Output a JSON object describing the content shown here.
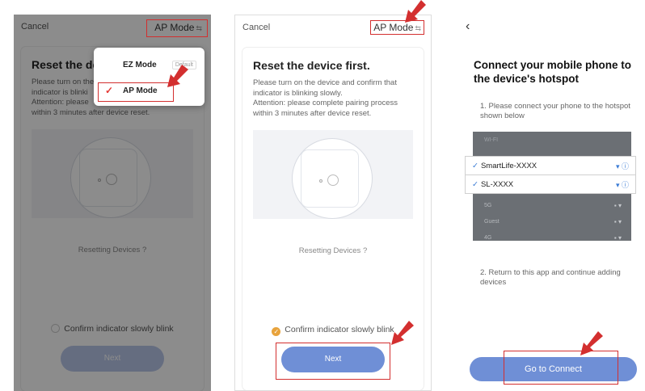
{
  "screen1": {
    "cancel": "Cancel",
    "mode": "AP Mode",
    "mode_icon": "⇆",
    "title": "Reset the de",
    "desc": "Please turn on the\nindicator is blinki\nAttention: please\nwithin 3 minutes after device reset.",
    "reset_link": "Resetting Devices ?",
    "confirm": "Confirm indicator slowly blink",
    "next": "Next",
    "dropdown": {
      "ez_label": "EZ Mode",
      "ez_tag": "Default",
      "ap_label": "AP Mode",
      "ap_tick": "✓"
    }
  },
  "screen2": {
    "cancel": "Cancel",
    "mode": "AP Mode",
    "mode_icon": "⇆",
    "title": "Reset the device first.",
    "desc": "Please turn on the device and confirm that\nindicator is blinking slowly.\nAttention: please complete pairing process\nwithin 3 minutes after device reset.",
    "reset_link": "Resetting Devices ?",
    "confirm": "Confirm indicator slowly blink",
    "confirm_tick": "✓",
    "next": "Next"
  },
  "screen3": {
    "back": "‹",
    "title": "Connect your mobile phone to the device's hotspot",
    "step1": "1. Please connect your phone to the hotspot shown below",
    "wifi_header": "WI-FI",
    "hotspot1": "SmartLife-XXXX",
    "hotspot2": "SL-XXXX",
    "other_networks": [
      "5G",
      "Guest",
      "4G"
    ],
    "step2": "2. Return to this app and continue adding devices",
    "button": "Go to Connect"
  },
  "colors": {
    "accent": "#6f8fd6",
    "highlight": "#d32f2f",
    "check": "#e8a33c"
  }
}
